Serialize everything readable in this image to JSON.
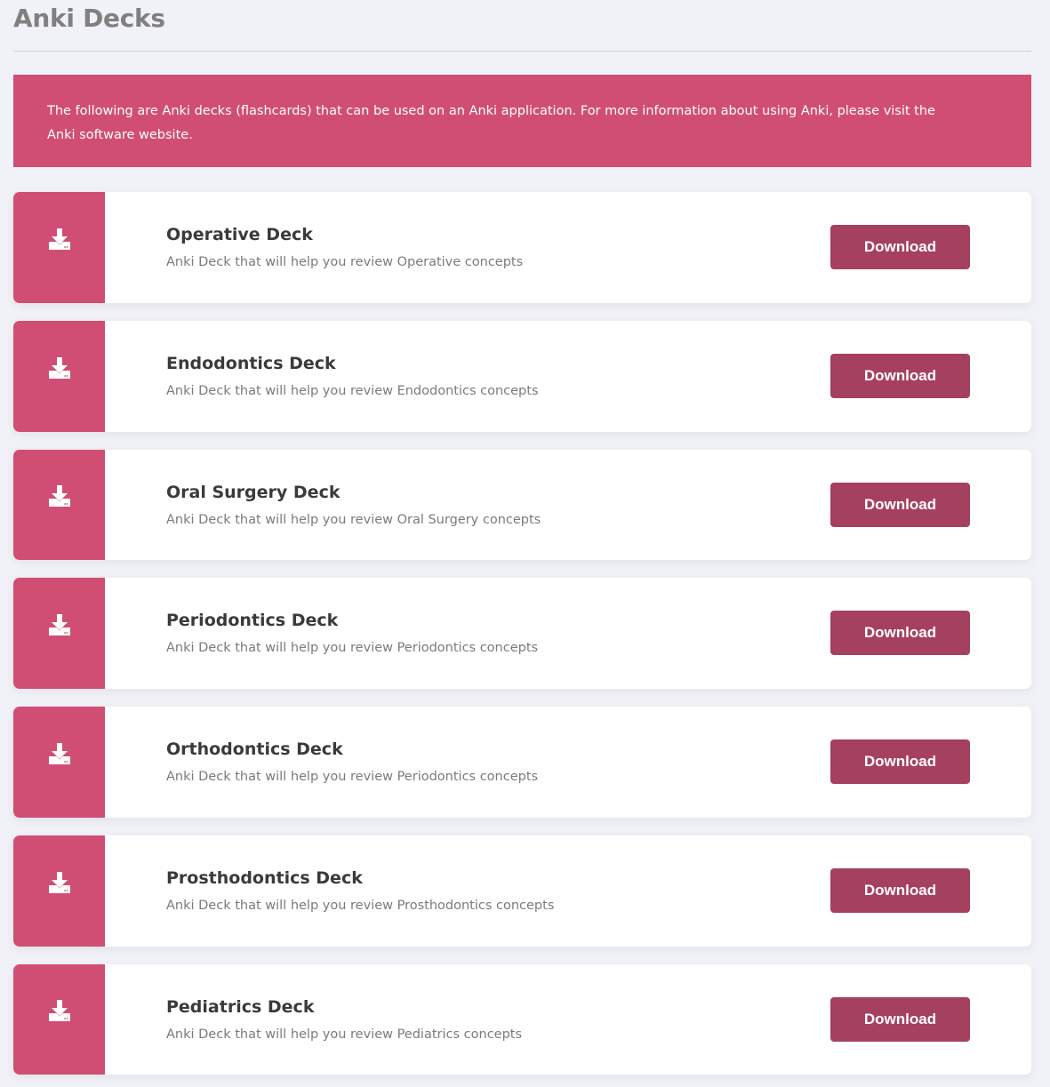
{
  "page": {
    "title": "Anki Decks"
  },
  "notice": {
    "text": "The following are Anki decks (flashcards) that can be used on an Anki application. For more information about using Anki, please visit the Anki software website."
  },
  "colors": {
    "accent": "#d04e74",
    "button": "#a6405f",
    "background": "#f1f2f7"
  },
  "decks": [
    {
      "name": "Operative Deck",
      "description": "Anki Deck that will help you review Operative concepts",
      "button_label": "Download",
      "icon": "download-icon"
    },
    {
      "name": "Endodontics Deck",
      "description": "Anki Deck that will help you review Endodontics concepts",
      "button_label": "Download",
      "icon": "download-icon"
    },
    {
      "name": "Oral Surgery Deck",
      "description": "Anki Deck that will help you review Oral Surgery concepts",
      "button_label": "Download",
      "icon": "download-icon"
    },
    {
      "name": "Periodontics Deck",
      "description": "Anki Deck that will help you review Periodontics concepts",
      "button_label": "Download",
      "icon": "download-icon"
    },
    {
      "name": "Orthodontics Deck",
      "description": "Anki Deck that will help you review Periodontics concepts",
      "button_label": "Download",
      "icon": "download-icon"
    },
    {
      "name": "Prosthodontics Deck",
      "description": "Anki Deck that will help you review Prosthodontics concepts",
      "button_label": "Download",
      "icon": "download-icon"
    },
    {
      "name": "Pediatrics Deck",
      "description": "Anki Deck that will help you review Pediatrics concepts",
      "button_label": "Download",
      "icon": "download-icon"
    }
  ]
}
